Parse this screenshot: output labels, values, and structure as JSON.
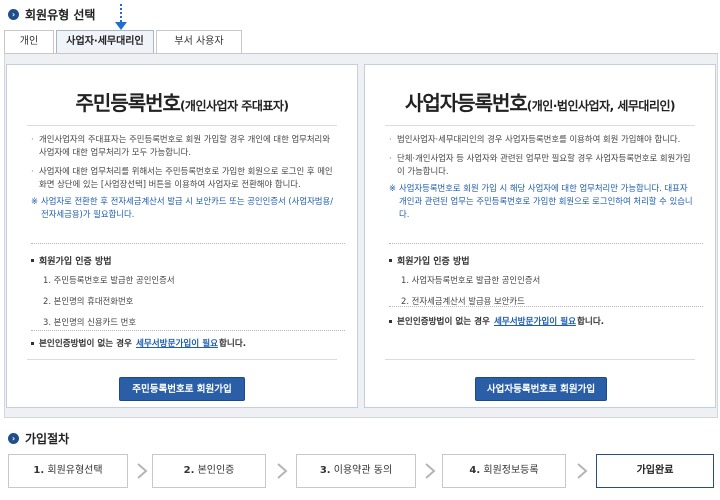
{
  "section1": {
    "title": "회원유형 선택"
  },
  "tabs": [
    {
      "label": "개인",
      "active": false
    },
    {
      "label": "사업자·세무대리인",
      "active": true
    },
    {
      "label": "부서 사용자",
      "active": false
    }
  ],
  "left_card": {
    "title_main": "주민등록번호",
    "title_sub": "(개인사업자 주대표자)",
    "bullets": [
      "개인사업자의 주대표자는 주민등록번호로 회원 가입할 경우 개인에 대한 업무처리와 사업자에 대한 업무처리가 모두 가능합니다.",
      "사업자에 대한 업무처리를 위해서는 주민등록번호로 가입한 회원으로 로그인 후 메인화면 상단에 있는 [사업장선택] 버튼을 이용하여 사업자로 전환해야 합니다."
    ],
    "note": "사업자로 전환한 후 전자세금계산서 발급 시 보안카드 또는 공인인증서 (사업자범용/전자세금용)가 필요합니다.",
    "method_title": "회원가입 인증 방법",
    "methods": [
      "1. 주민등록번호로 발급한 공인인증서",
      "2. 본인명의 휴대전화번호",
      "3. 본인명의 신용카드 번호"
    ],
    "visit_pre": "본인인증방법이 없는 경우",
    "visit_link": "세무서방문가입이 필요",
    "visit_post": "합니다.",
    "button": "주민등록번호로 회원가입"
  },
  "right_card": {
    "title_main": "사업자등록번호",
    "title_sub": "(개인·법인사업자, 세무대리인)",
    "bullets": [
      "법인사업자·세무대리인의 경우 사업자등록번호를 이용하여 회원 가입해야 합니다.",
      "단체·개인사업자 등 사업자와 관련된 업무만 필요할 경우 사업자등록번호로 회원가입이 가능합니다."
    ],
    "note": "사업자등록번호로 회원 가입 시 해당 사업자에 대한 업무처리만 가능합니다. 대표자 개인과 관련된 업무는 주민등록번호로 가입한 회원으로 로그인하여 처리할 수 있습니다.",
    "method_title": "회원가입 인증 방법",
    "methods": [
      "1. 사업자등록번호로 발급한 공인인증서",
      "2. 전자세금계산서 발급용 보안카드"
    ],
    "visit_pre": "본인인증방법이 없는 경우",
    "visit_link": "세무서방문가입이 필요",
    "visit_post": "합니다.",
    "button": "사업자등록번호로 회원가입"
  },
  "section2": {
    "title": "가입절차"
  },
  "steps": [
    {
      "num": "1.",
      "label": "회원유형선택",
      "current": false
    },
    {
      "num": "2.",
      "label": "본인인증",
      "current": false
    },
    {
      "num": "3.",
      "label": "이용약관 동의",
      "current": false
    },
    {
      "num": "4.",
      "label": "회원정보등록",
      "current": false
    },
    {
      "num": "",
      "label": "가입완료",
      "current": true
    }
  ],
  "colors": {
    "accent": "#2a5fa8",
    "note": "#1f5db0",
    "bullet_icon": "#1f4e8c"
  }
}
